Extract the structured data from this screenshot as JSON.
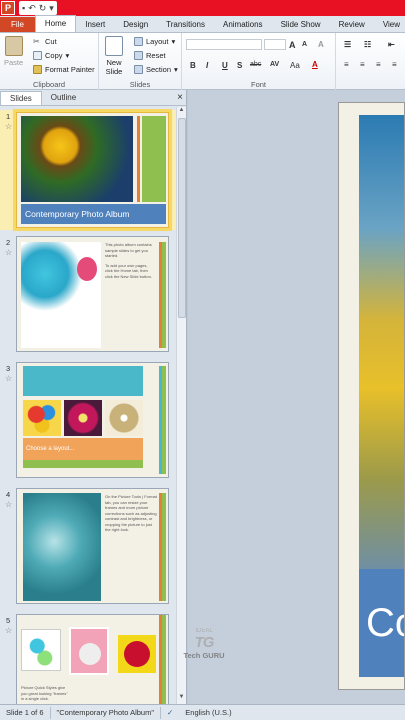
{
  "quick_access": {
    "app_icon": "P",
    "icons": [
      "save-icon",
      "undo-icon",
      "redo-icon",
      "customize-icon"
    ]
  },
  "tabs": [
    "File",
    "Home",
    "Insert",
    "Design",
    "Transitions",
    "Animations",
    "Slide Show",
    "Review",
    "View"
  ],
  "ribbon": {
    "clipboard": {
      "label": "Clipboard",
      "paste": "Paste",
      "cut": "Cut",
      "copy": "Copy",
      "format_painter": "Format Painter"
    },
    "slides": {
      "label": "Slides",
      "new_slide": "New",
      "new_slide2": "Slide",
      "layout": "Layout",
      "reset": "Reset",
      "section": "Section"
    },
    "font": {
      "label": "Font",
      "bold": "B",
      "italic": "I",
      "underline": "U",
      "shadow": "S",
      "strike": "abc",
      "spacing": "AV",
      "case": "Aa",
      "grow": "A",
      "shrink": "A",
      "clear": "A"
    }
  },
  "pane": {
    "tabs": [
      "Slides",
      "Outline"
    ],
    "close": "×",
    "slides": [
      {
        "number": "1",
        "title": "Contemporary Photo Album"
      },
      {
        "number": "2",
        "body": [
          "This photo album contains sample slides to get you started.",
          "To add your own pages, click the Home tab, then click the New Slide button."
        ]
      },
      {
        "number": "3",
        "title": "Choose a layout..."
      },
      {
        "number": "4",
        "body": [
          "On the Picture Tools | Format tab, you can resize your frames and more picture corrections such as adjusting contrast and brightness, or cropping the picture to just the right look."
        ]
      },
      {
        "number": "5",
        "body": [
          "Picture Quick Styles give you great looking \"frames\" in a single click."
        ]
      }
    ]
  },
  "editor": {
    "slide_text": "Co"
  },
  "watermark": {
    "top": "IDEAL",
    "name": "Tech GURU"
  },
  "status": {
    "slide": "Slide 1 of 6",
    "theme": "\"Contemporary Photo Album\"",
    "language": "English (U.S.)"
  },
  "colors": {
    "file_tab": "#d24726",
    "title_bar": "#e81123",
    "selected": "#f6d867",
    "slide_blue": "#4f81bd"
  }
}
